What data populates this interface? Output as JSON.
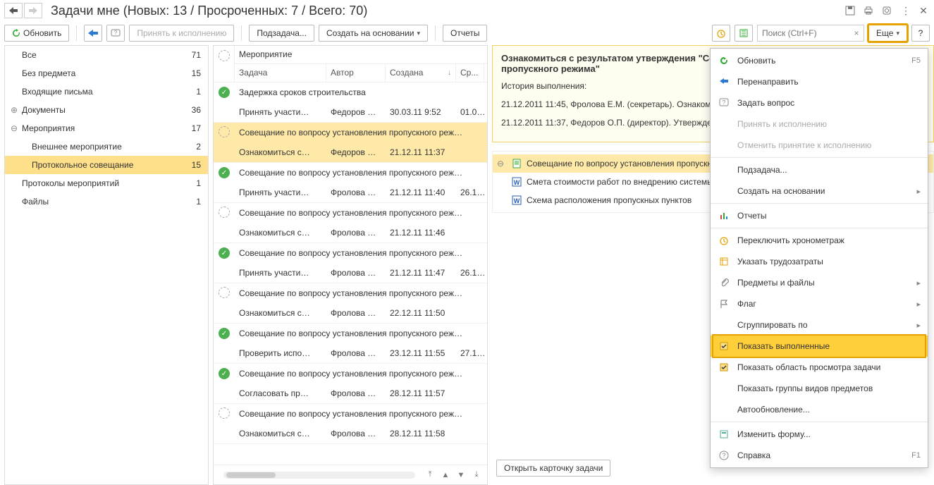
{
  "title": "Задачи мне (Новых: 13 / Просроченных: 7 / Всего: 70)",
  "toolbar": {
    "refresh": "Обновить",
    "accept": "Принять к исполнению",
    "subtask": "Подзадача...",
    "create_based": "Создать на основании",
    "reports": "Отчеты",
    "search_placeholder": "Поиск (Ctrl+F)",
    "more": "Еще",
    "help": "?"
  },
  "sidebar": [
    {
      "label": "Все",
      "count": "71",
      "exp": "",
      "indent": 0
    },
    {
      "label": "Без предмета",
      "count": "15",
      "exp": "",
      "indent": 0
    },
    {
      "label": "Входящие письма",
      "count": "1",
      "exp": "",
      "indent": 0
    },
    {
      "label": "Документы",
      "count": "36",
      "exp": "⊕",
      "indent": 0
    },
    {
      "label": "Мероприятия",
      "count": "17",
      "exp": "⊖",
      "indent": 0
    },
    {
      "label": "Внешнее мероприятие",
      "count": "2",
      "exp": "",
      "indent": 1
    },
    {
      "label": "Протокольное совещание",
      "count": "15",
      "exp": "",
      "indent": 1,
      "sel": true
    },
    {
      "label": "Протоколы мероприятий",
      "count": "1",
      "exp": "",
      "indent": 0
    },
    {
      "label": "Файлы",
      "count": "1",
      "exp": "",
      "indent": 0
    }
  ],
  "task_header": {
    "event": "Мероприятие",
    "task": "Задача",
    "author": "Автор",
    "created": "Создана",
    "due": "Ср..."
  },
  "tasks": [
    {
      "done": true,
      "event": "Задержка сроков строительства",
      "task": "Принять участи…",
      "author": "Федоров …",
      "created": "30.03.11 9:52",
      "due": "01.0…"
    },
    {
      "done": false,
      "event": "Совещание по вопросу установления пропускного реж…",
      "task": "Ознакомиться с…",
      "author": "Федоров …",
      "created": "21.12.11 11:37",
      "due": "",
      "sel": true
    },
    {
      "done": true,
      "event": "Совещание по вопросу установления пропускного реж…",
      "task": "Принять участи…",
      "author": "Фролова …",
      "created": "21.12.11 11:40",
      "due": "26.1…"
    },
    {
      "done": false,
      "event": "Совещание по вопросу установления пропускного реж…",
      "task": "Ознакомиться с…",
      "author": "Фролова …",
      "created": "21.12.11 11:46",
      "due": ""
    },
    {
      "done": true,
      "event": "Совещание по вопросу установления пропускного реж…",
      "task": "Принять участи…",
      "author": "Фролова …",
      "created": "21.12.11 11:47",
      "due": "26.1…"
    },
    {
      "done": false,
      "event": "Совещание по вопросу установления пропускного реж…",
      "task": "Ознакомиться с…",
      "author": "Фролова …",
      "created": "22.12.11 11:50",
      "due": ""
    },
    {
      "done": true,
      "event": "Совещание по вопросу установления пропускного реж…",
      "task": "Проверить испо…",
      "author": "Фролова …",
      "created": "23.12.11 11:55",
      "due": "27.1…"
    },
    {
      "done": true,
      "event": "Совещание по вопросу установления пропускного реж…",
      "task": "Согласовать пр…",
      "author": "Фролова …",
      "created": "28.12.11 11:57",
      "due": ""
    },
    {
      "done": false,
      "event": "Совещание по вопросу установления пропускного реж…",
      "task": "Ознакомиться с…",
      "author": "Фролова …",
      "created": "28.12.11 11:58",
      "due": ""
    }
  ],
  "detail": {
    "title": "Ознакомиться с результатом утверждения \"Совещание по вопросу установления пропускного режима\"",
    "hist_label": "История выполнения:",
    "line1": "21.12.2011 11:45, Фролова Е.М. (секретарь). Ознакомлена с результатами утверждения.",
    "line2": "21.12.2011 11:37, Федоров О.П. (директор). Утверждено.",
    "files": [
      {
        "icon": "doc",
        "label": "Совещание по вопросу установления пропускного режима",
        "head": true
      },
      {
        "icon": "word",
        "label": "Смета стоимости работ по внедрению системы"
      },
      {
        "icon": "word",
        "label": "Схема расположения пропускных пунктов"
      }
    ],
    "open_card": "Открыть карточку задачи"
  },
  "menu": [
    {
      "icon": "refresh",
      "label": "Обновить",
      "shortcut": "F5",
      "color": "#3a3"
    },
    {
      "icon": "redirect",
      "label": "Перенаправить",
      "color": "#2a7ad4"
    },
    {
      "icon": "question",
      "label": "Задать вопрос",
      "color": "#888"
    },
    {
      "icon": "",
      "label": "Принять к исполнению",
      "dis": true
    },
    {
      "icon": "",
      "label": "Отменить принятие к исполнению",
      "dis": true
    },
    {
      "sep": true
    },
    {
      "icon": "",
      "label": "Подзадача..."
    },
    {
      "icon": "",
      "label": "Создать на основании",
      "sub": "▸"
    },
    {
      "sep": true
    },
    {
      "icon": "reports",
      "label": "Отчеты",
      "color": "#d44"
    },
    {
      "sep": true
    },
    {
      "icon": "clock",
      "label": "Переключить хронометраж",
      "color": "#e5a200"
    },
    {
      "icon": "effort",
      "label": "Указать трудозатраты",
      "color": "#e5a200"
    },
    {
      "icon": "clip",
      "label": "Предметы и файлы",
      "sub": "▸",
      "color": "#888"
    },
    {
      "icon": "flag",
      "label": "Флаг",
      "sub": "▸",
      "color": "#888"
    },
    {
      "icon": "",
      "label": "Сгруппировать по",
      "sub": "▸"
    },
    {
      "icon": "check",
      "label": "Показать выполненные",
      "hi": true
    },
    {
      "icon": "check",
      "label": "Показать область просмотра задачи"
    },
    {
      "icon": "",
      "label": "Показать группы видов предметов"
    },
    {
      "icon": "",
      "label": "Автообновление..."
    },
    {
      "sep": true
    },
    {
      "icon": "form",
      "label": "Изменить форму...",
      "color": "#5a9"
    },
    {
      "icon": "help",
      "label": "Справка",
      "shortcut": "F1",
      "color": "#888"
    }
  ]
}
